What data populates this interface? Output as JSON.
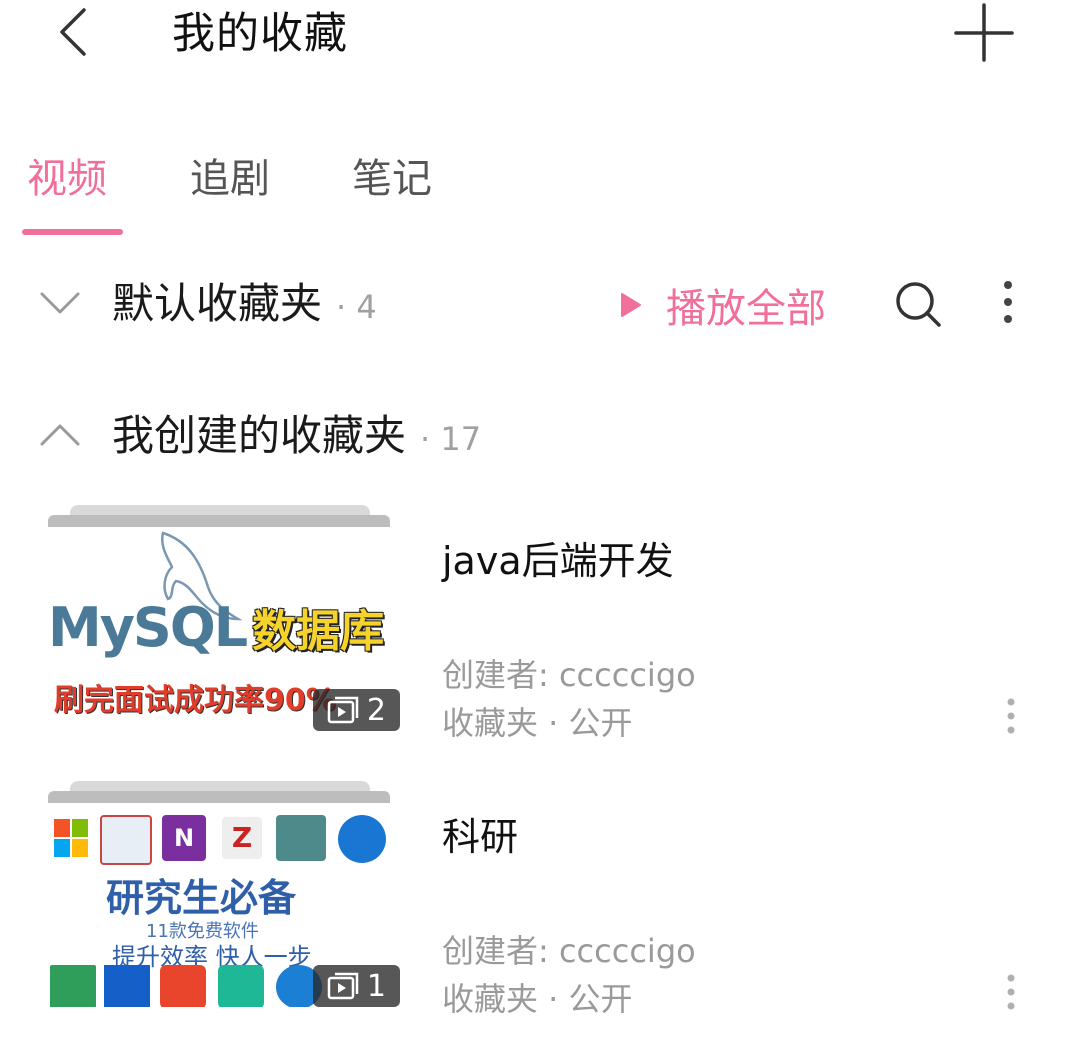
{
  "header": {
    "title": "我的收藏"
  },
  "tabs": [
    {
      "label": "视频",
      "active": true
    },
    {
      "label": "追剧",
      "active": false
    },
    {
      "label": "笔记",
      "active": false
    }
  ],
  "default_folder": {
    "title": "默认收藏夹",
    "count": "· 4",
    "play_all_label": "播放全部"
  },
  "created_folders": {
    "title": "我创建的收藏夹",
    "count": "· 17",
    "items": [
      {
        "title": "java后端开发",
        "creator": "创建者: cccccigo",
        "meta": "收藏夹 · 公开",
        "video_count": "2",
        "thumb": {
          "brand_text": "MySQL",
          "highlight_text": "数据库",
          "sub_text": "刷完面试成功率90%"
        }
      },
      {
        "title": "科研",
        "creator": "创建者: cccccigo",
        "meta": "收藏夹 · 公开",
        "video_count": "1",
        "thumb": {
          "main_text": "研究生必备",
          "small_text": "11款免费软件",
          "sub_text": "提升效率 快人一步"
        }
      }
    ]
  },
  "colors": {
    "accent": "#f0709a",
    "secondary_text": "#9a9a9a"
  }
}
